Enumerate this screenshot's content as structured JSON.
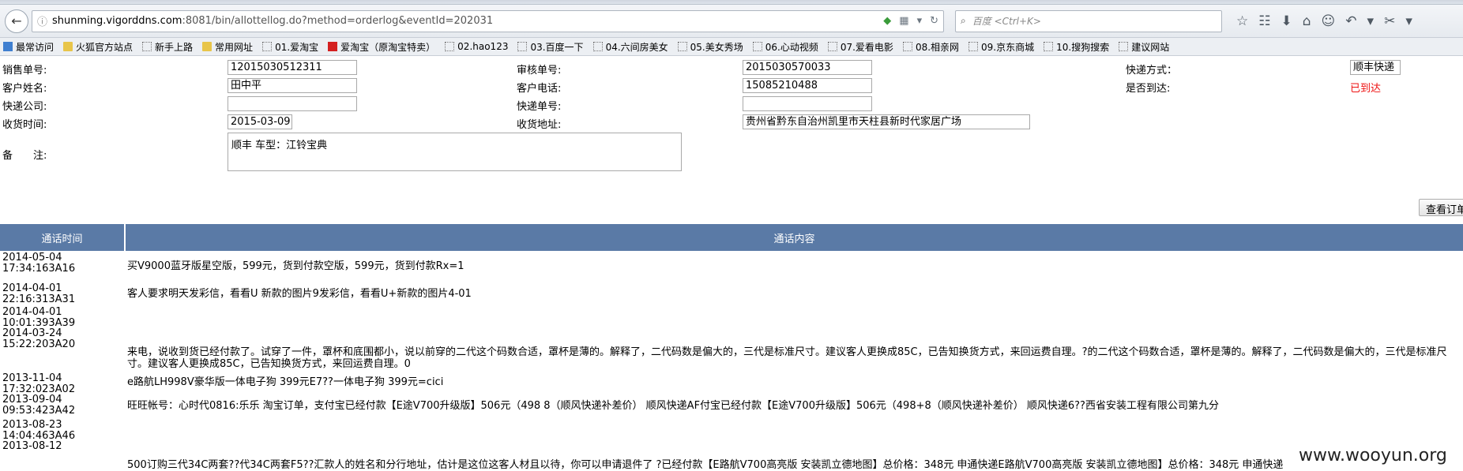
{
  "browser": {
    "url_host": "shunming.vigorddns.com",
    "url_rest": ":8081/bin/allottellog.do?method=orderlog&eventId=202031",
    "search_placeholder": "百度 <Ctrl+K>",
    "bookmarks": [
      {
        "label": "最常访问",
        "icon": "fav"
      },
      {
        "label": "火狐官方站点",
        "icon": "folder"
      },
      {
        "label": "新手上路",
        "icon": "page"
      },
      {
        "label": "常用网址",
        "icon": "folder"
      },
      {
        "label": "01.爱淘宝",
        "icon": "page"
      },
      {
        "label": "爱淘宝（原淘宝特卖）",
        "icon": "tb"
      },
      {
        "label": "02.hao123",
        "icon": "page"
      },
      {
        "label": "03.百度一下",
        "icon": "page"
      },
      {
        "label": "04.六间房美女",
        "icon": "page"
      },
      {
        "label": "05.美女秀场",
        "icon": "page"
      },
      {
        "label": "06.心动视频",
        "icon": "page"
      },
      {
        "label": "07.爱看电影",
        "icon": "page"
      },
      {
        "label": "08.相亲网",
        "icon": "page"
      },
      {
        "label": "09.京东商城",
        "icon": "page"
      },
      {
        "label": "10.搜狗搜索",
        "icon": "page"
      },
      {
        "label": "建议网站",
        "icon": "page"
      }
    ]
  },
  "form": {
    "sale_no_label": "销售单号:",
    "sale_no": "12015030512311",
    "audit_no_label": "审核单号:",
    "audit_no": "2015030570033",
    "ship_method_label": "快递方式：",
    "ship_method": "顺丰快递",
    "customer_name_label": "客户姓名:",
    "customer_name": "田中平",
    "customer_phone_label": "客户电话:",
    "customer_phone": "15085210488",
    "arrived_label": "是否到达:",
    "arrived_value": "已到达",
    "courier_label": "快递公司:",
    "courier": "",
    "tracking_label": "快递单号:",
    "tracking": "",
    "receive_time_label": "收货时间:",
    "receive_time": "2015-03-09",
    "address_label": "收货地址:",
    "address": "贵州省黔东自治州凯里市天柱县新时代家居广场",
    "remark_label": "备　　注:",
    "remark": "顺丰 车型：江铃宝典",
    "query_button": "查看订单"
  },
  "call_log": {
    "headers": {
      "time": "通话时间",
      "content": "通话内容"
    },
    "rows": [
      {
        "time": "2014-05-04 17:34:163A16",
        "content": "买V9000蓝牙版星空版，599元，货到付款空版，599元，货到付款Rx=1"
      },
      {
        "time": "2014-04-01 22:16:313A31",
        "content": "客人要求明天发彩信，看看U 新款的图片9发彩信，看看U+新款的图片4-01"
      },
      {
        "time": "2014-04-01 10:01:393A39",
        "content": ""
      },
      {
        "time": "2014-03-24 15:22:203A20",
        "content": "来电，说收到货已经付款了。试穿了一件，罩杯和底围都小，说以前穿的二代这个码数合适，罩杯是薄的。解释了，二代码数是偏大的，三代是标准尺寸。建议客人更换成85C，已告知换货方式，来回运费自理。?的二代这个码数合适，罩杯是薄的。解释了，二代码数是偏大的，三代是标准尺寸。建议客人更换成85C，已告知换货方式，来回运费自理。0"
      },
      {
        "time": "2013-11-04 17:32:023A02",
        "content": "e路航LH998V豪华版一体电子狗 399元E7??一体电子狗 399元=cici"
      },
      {
        "time": "2013-09-04 09:53:423A42",
        "content": "旺旺帐号：心时代0816:乐乐 淘宝订单，支付宝已经付款【E途V700升级版】506元（498 8（顺风快递补差价） 顺风快递AF付宝已经付款【E途V700升级版】506元（498+8（顺风快递补差价） 顺风快递6??西省安装工程有限公司第九分"
      },
      {
        "time": "2013-08-23 14:04:463A46",
        "content": ""
      },
      {
        "time": "2013-08-12",
        "content": "500订购三代34C两套??代34C两套F5??汇款人的姓名和分行地址，估计是这位这客人材且以待，你可以申请退件了 ?已经付款【E路航V700高亮版 安装凯立德地图】总价格：348元 申通快递E路航V700高亮版 安装凯立德地图】总价格：348元 申通快递"
      }
    ]
  },
  "watermark": "www.wooyun.org"
}
